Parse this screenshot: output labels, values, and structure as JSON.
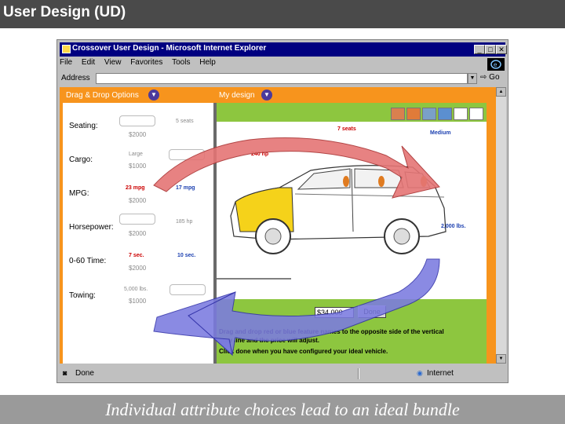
{
  "slide": {
    "title": "User Design (UD)",
    "caption": "Individual attribute choices lead to an ideal bundle"
  },
  "browser": {
    "window_title": "Crossover User Design - Microsoft Internet Explorer",
    "menu": [
      "File",
      "Edit",
      "View",
      "Favorites",
      "Tools",
      "Help"
    ],
    "address_label": "Address",
    "address_value": "",
    "go_label": "Go",
    "status_text": "Done",
    "zone_text": "Internet"
  },
  "app": {
    "drag_drop_label": "Drag & Drop Options",
    "my_design_label": "My design",
    "swatch_colors": [
      "#d9804f",
      "#e07b39",
      "#7aa0c8",
      "#5b8fd0",
      "#ffffff",
      "#ffffff"
    ],
    "rows": [
      {
        "label": "Seating:",
        "options": [
          {
            "text": "5 seats",
            "color": "gray"
          }
        ],
        "price": "$2000"
      },
      {
        "label": "Cargo:",
        "options": [
          {
            "text": "Large",
            "color": "gray"
          }
        ],
        "price": "$1000"
      },
      {
        "label": "MPG:",
        "options": [
          {
            "text": "23 mpg",
            "color": "red"
          },
          {
            "text": "17 mpg",
            "color": "blue"
          }
        ],
        "price": "$2000"
      },
      {
        "label": "Horsepower:",
        "options": [
          {
            "text": "185 hp",
            "color": "gray"
          }
        ],
        "price": "$2000"
      },
      {
        "label": "0-60 Time:",
        "options": [
          {
            "text": "7 sec.",
            "color": "red"
          },
          {
            "text": "10 sec.",
            "color": "blue"
          }
        ],
        "price": "$2000"
      },
      {
        "label": "Towing:",
        "options": [
          {
            "text": "5,000 lbs.",
            "color": "gray"
          }
        ],
        "price": "$1000"
      }
    ],
    "car_labels": {
      "seats": "7 seats",
      "cargo": "Medium",
      "horsepower": "240 hp",
      "towing": "2,000 lbs."
    },
    "price_value": "$34,000",
    "done_label": "Done",
    "instructions": [
      "Drag and drop red or blue feature names to the opposite side of the vertical",
      "gray line and the price will adjust.",
      "Click done when you have configured your ideal vehicle."
    ]
  }
}
